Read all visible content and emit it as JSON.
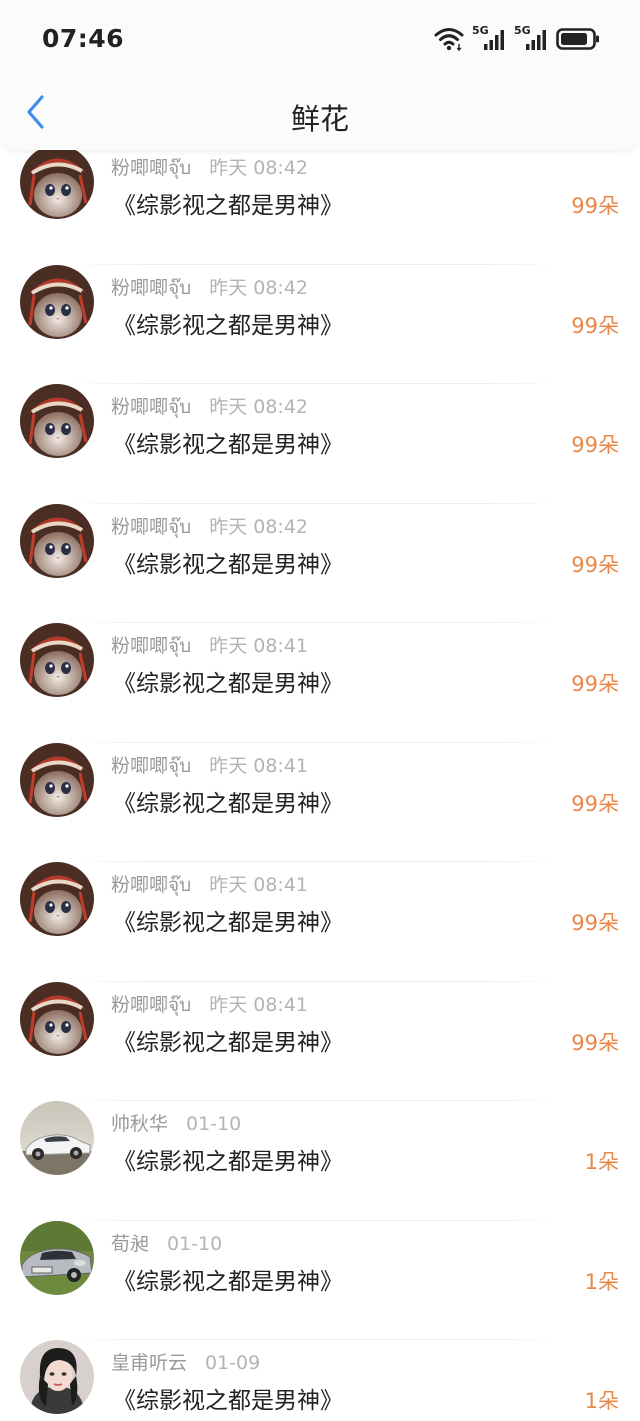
{
  "status_bar": {
    "time": "07:46",
    "network_1": "5G",
    "network_2": "5G"
  },
  "header": {
    "title": "鲜花"
  },
  "records": [
    {
      "user": "粉唧唧จุ๊บ",
      "time": "昨天 08:42",
      "book": "《综影视之都是男神》",
      "count": "99朵",
      "avatar": "cat-avatar"
    },
    {
      "user": "粉唧唧จุ๊บ",
      "time": "昨天 08:42",
      "book": "《综影视之都是男神》",
      "count": "99朵",
      "avatar": "cat-avatar"
    },
    {
      "user": "粉唧唧จุ๊บ",
      "time": "昨天 08:42",
      "book": "《综影视之都是男神》",
      "count": "99朵",
      "avatar": "cat-avatar"
    },
    {
      "user": "粉唧唧จุ๊บ",
      "time": "昨天 08:42",
      "book": "《综影视之都是男神》",
      "count": "99朵",
      "avatar": "cat-avatar"
    },
    {
      "user": "粉唧唧จุ๊บ",
      "time": "昨天 08:41",
      "book": "《综影视之都是男神》",
      "count": "99朵",
      "avatar": "cat-avatar"
    },
    {
      "user": "粉唧唧จุ๊บ",
      "time": "昨天 08:41",
      "book": "《综影视之都是男神》",
      "count": "99朵",
      "avatar": "cat-avatar"
    },
    {
      "user": "粉唧唧จุ๊บ",
      "time": "昨天 08:41",
      "book": "《综影视之都是男神》",
      "count": "99朵",
      "avatar": "cat-avatar"
    },
    {
      "user": "粉唧唧จุ๊บ",
      "time": "昨天 08:41",
      "book": "《综影视之都是男神》",
      "count": "99朵",
      "avatar": "cat-avatar"
    },
    {
      "user": "帅秋华",
      "time": "01-10",
      "book": "《综影视之都是男神》",
      "count": "1朵",
      "avatar": "car-avatar"
    },
    {
      "user": "荀昶",
      "time": "01-10",
      "book": "《综影视之都是男神》",
      "count": "1朵",
      "avatar": "silver-car-avatar"
    },
    {
      "user": "皇甫听云",
      "time": "01-09",
      "book": "《综影视之都是男神》",
      "count": "1朵",
      "avatar": "person-avatar"
    }
  ]
}
